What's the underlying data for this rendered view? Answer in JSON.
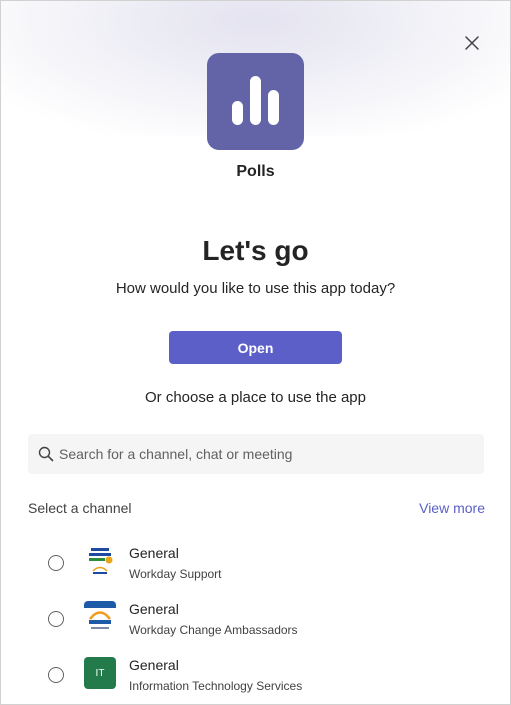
{
  "app": {
    "name": "Polls",
    "icon": "bar-chart-icon",
    "accent_color": "#6264a7"
  },
  "header": {
    "close_icon": "close-icon"
  },
  "main": {
    "headline": "Let's go",
    "subtitle": "How would you like to use this app today?",
    "open_button_label": "Open",
    "open_button_color": "#5b5fc7",
    "choose_text": "Or choose a place to use the app"
  },
  "search": {
    "placeholder": "Search for a channel, chat or meeting",
    "value": "",
    "icon": "search-icon"
  },
  "channels": {
    "section_label": "Select a channel",
    "view_more_label": "View more",
    "items": [
      {
        "channel": "General",
        "team": "Workday Support",
        "avatar": "fgcu-workday-logo",
        "selected": false
      },
      {
        "channel": "General",
        "team": "Workday Change Ambassadors",
        "avatar": "workday-logo",
        "selected": false
      },
      {
        "channel": "General",
        "team": "Information Technology Services",
        "avatar": "it-initials",
        "avatar_initials": "IT",
        "avatar_color": "#237b4b",
        "selected": false
      }
    ]
  }
}
